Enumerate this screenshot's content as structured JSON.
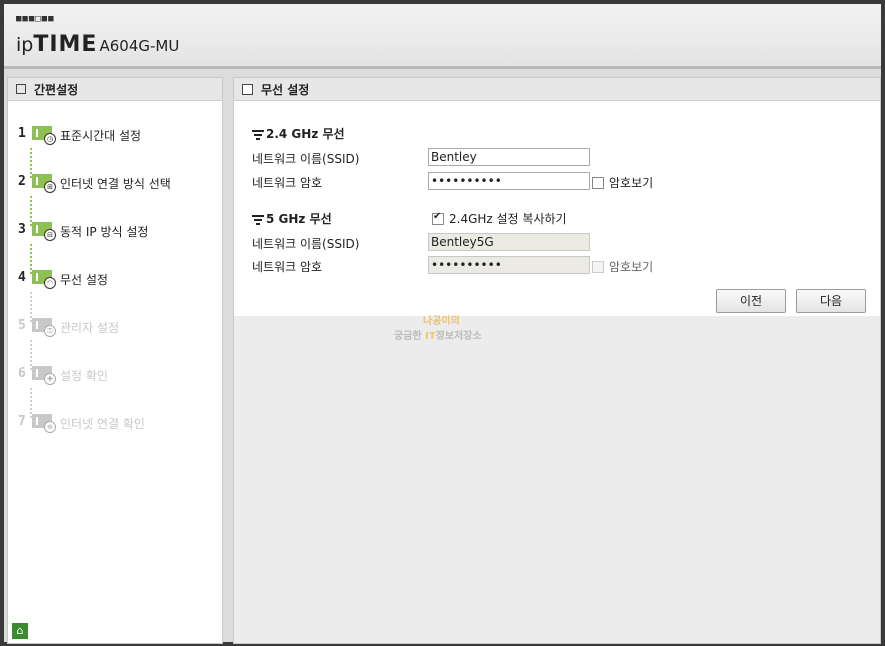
{
  "header": {
    "logo_dots": "■■■□■■",
    "brand_ip": "ip",
    "brand_time": "TIME",
    "model": "A604G-MU"
  },
  "sidebar": {
    "title": "간편설정",
    "steps": [
      {
        "num": "1",
        "label": "표준시간대 설정",
        "icon": "clock-icon",
        "active": true
      },
      {
        "num": "2",
        "label": "인터넷 연결 방식 선택",
        "icon": "network-icon",
        "active": true
      },
      {
        "num": "3",
        "label": "동적 IP 방식 설정",
        "icon": "ip-icon",
        "active": true
      },
      {
        "num": "4",
        "label": "무선 설정",
        "icon": "wireless-icon",
        "active": true
      },
      {
        "num": "5",
        "label": "관리자 설정",
        "icon": "admin-lock-icon",
        "active": false
      },
      {
        "num": "6",
        "label": "설정 확인",
        "icon": "confirm-icon",
        "active": false
      },
      {
        "num": "7",
        "label": "인터넷 연결 확인",
        "icon": "globe-icon",
        "active": false
      }
    ],
    "home_icon": "home-icon"
  },
  "main": {
    "title": "무선 설정",
    "wifi24": {
      "title": "2.4 GHz 무선",
      "ssid_label": "네트워크 이름(SSID)",
      "ssid_value": "Bentley",
      "password_label": "네트워크 암호",
      "password_value": "••••••••••",
      "show_password_label": "암호보기"
    },
    "wifi5": {
      "title": "5 GHz 무선",
      "copy_label": "2.4GHz 설정 복사하기",
      "copy_checked": true,
      "ssid_label": "네트워크 이름(SSID)",
      "ssid_value": "Bentley5G",
      "password_label": "네트워크 암호",
      "password_value": "••••••••••",
      "show_password_label": "암호보기"
    },
    "prev_button": "이전",
    "next_button": "다음",
    "watermark_line1": "나공이의",
    "watermark_line2a": "궁금한",
    "watermark_line2b": "IT",
    "watermark_line2c": "정보저장소"
  },
  "colors": {
    "step_active": "#8fc056",
    "step_inactive": "#c8c8c8",
    "home": "#3b8a2f"
  }
}
